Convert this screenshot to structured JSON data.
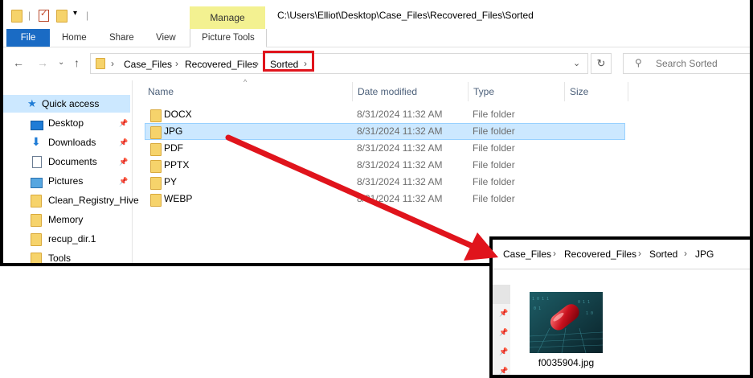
{
  "titlebar": {
    "manage_label": "Manage",
    "path": "C:\\Users\\Elliot\\Desktop\\Case_Files\\Recovered_Files\\Sorted"
  },
  "ribbon": {
    "tabs": [
      "File",
      "Home",
      "Share",
      "View",
      "Picture Tools"
    ]
  },
  "address": {
    "crumbs": [
      "Case_Files",
      "Recovered_Files",
      "Sorted"
    ],
    "search_placeholder": "Search Sorted"
  },
  "nav": {
    "items": [
      {
        "label": "Quick access",
        "icon": "star-icon"
      },
      {
        "label": "Desktop",
        "icon": "desktop-icon"
      },
      {
        "label": "Downloads",
        "icon": "download-icon"
      },
      {
        "label": "Documents",
        "icon": "documents-icon"
      },
      {
        "label": "Pictures",
        "icon": "pictures-icon"
      },
      {
        "label": "Clean_Registry_Hive",
        "icon": "folder-icon"
      },
      {
        "label": "Memory",
        "icon": "folder-icon"
      },
      {
        "label": "recup_dir.1",
        "icon": "folder-icon"
      },
      {
        "label": "Tools",
        "icon": "folder-icon"
      }
    ]
  },
  "columns": [
    "Name",
    "Date modified",
    "Type",
    "Size"
  ],
  "files": [
    {
      "name": "DOCX",
      "date": "8/31/2024 11:32 AM",
      "type": "File folder"
    },
    {
      "name": "JPG",
      "date": "8/31/2024 11:32 AM",
      "type": "File folder"
    },
    {
      "name": "PDF",
      "date": "8/31/2024 11:32 AM",
      "type": "File folder"
    },
    {
      "name": "PPTX",
      "date": "8/31/2024 11:32 AM",
      "type": "File folder"
    },
    {
      "name": "PY",
      "date": "8/31/2024 11:32 AM",
      "type": "File folder"
    },
    {
      "name": "WEBP",
      "date": "8/31/2024 11:32 AM",
      "type": "File folder"
    }
  ],
  "inset": {
    "crumbs": [
      "Case_Files",
      "Recovered_Files",
      "Sorted",
      "JPG"
    ],
    "file_name": "f0035904.jpg"
  },
  "colors": {
    "accent": "#1a6bc4",
    "highlight_red": "#e0141c",
    "selection": "#cce8ff",
    "manage_tab": "#f3f191"
  }
}
